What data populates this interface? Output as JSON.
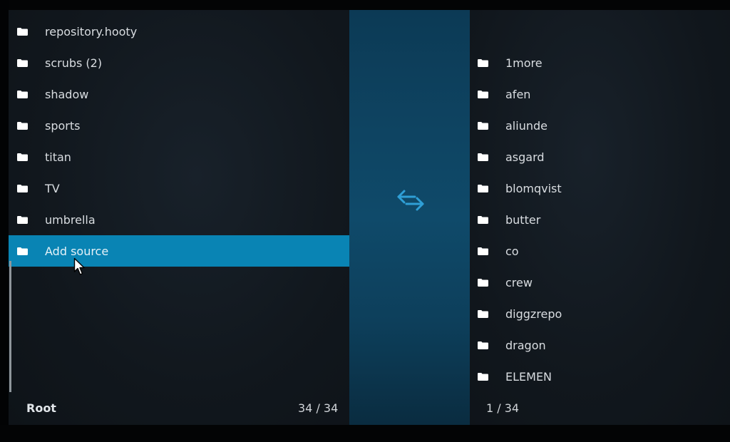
{
  "left_pane": {
    "items": [
      {
        "label": "repository.hooty",
        "icon": "folder-icon",
        "selected": false
      },
      {
        "label": "scrubs (2)",
        "icon": "folder-icon",
        "selected": false
      },
      {
        "label": "shadow",
        "icon": "folder-icon",
        "selected": false
      },
      {
        "label": "sports",
        "icon": "folder-icon",
        "selected": false
      },
      {
        "label": "titan",
        "icon": "folder-icon",
        "selected": false
      },
      {
        "label": "TV",
        "icon": "folder-icon",
        "selected": false
      },
      {
        "label": "umbrella",
        "icon": "folder-icon",
        "selected": false
      },
      {
        "label": "Add source",
        "icon": "folder-icon",
        "selected": true
      }
    ],
    "footer": {
      "path": "Root",
      "count": "34 / 34"
    }
  },
  "center": {
    "swap_icon": "swap-arrows-icon",
    "accent": "#0f4a6a"
  },
  "right_pane": {
    "items": [
      {
        "label": "1more",
        "icon": "folder-icon"
      },
      {
        "label": "afen",
        "icon": "folder-icon"
      },
      {
        "label": "aliunde",
        "icon": "folder-icon"
      },
      {
        "label": "asgard",
        "icon": "folder-icon"
      },
      {
        "label": "blomqvist",
        "icon": "folder-icon"
      },
      {
        "label": "butter",
        "icon": "folder-icon"
      },
      {
        "label": "co",
        "icon": "folder-icon"
      },
      {
        "label": "crew",
        "icon": "folder-icon"
      },
      {
        "label": "diggzrepo",
        "icon": "folder-icon"
      },
      {
        "label": "dragon",
        "icon": "folder-icon"
      },
      {
        "label": "ELEMEN",
        "icon": "folder-icon"
      }
    ],
    "footer": {
      "count": "1 / 34"
    }
  },
  "colors": {
    "selection": "#0984b4",
    "background": "#11171d",
    "text": "#d9dde1"
  }
}
